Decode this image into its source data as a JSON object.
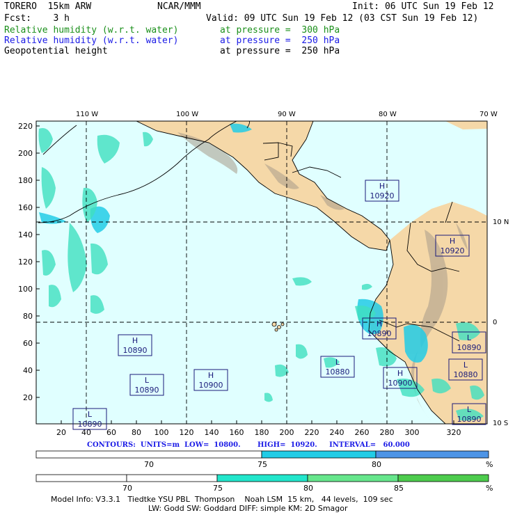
{
  "header": {
    "model": "TORERO  15km ARW",
    "org": "NCAR/MMM",
    "init": "Init: 06 UTC Sun 19 Feb 12",
    "fcst": "Fcst:    3 h",
    "valid": "Valid: 09 UTC Sun 19 Feb 12 (03 CST Sun 19 Feb 12)",
    "fields": [
      {
        "name": "Relative humidity (w.r.t. water)",
        "level": "at pressure =  300 hPa",
        "color": "#1a8f1a"
      },
      {
        "name": "Relative humidity (w.r.t. water)",
        "level": "at pressure =  250 hPa",
        "color": "#1a1ae6"
      },
      {
        "name": "Geopotential height",
        "level": "at pressure =  250 hPa",
        "color": "#000000"
      }
    ]
  },
  "map": {
    "lon_labels": [
      "110 W",
      "100 W",
      "90 W",
      "80 W",
      "70 W"
    ],
    "lat_labels": [
      "10 N",
      "0",
      "10 S"
    ],
    "y_ticks": [
      "220",
      "200",
      "180",
      "160",
      "140",
      "120",
      "100",
      "80",
      "60",
      "40",
      "20"
    ],
    "x_ticks": [
      "20",
      "40",
      "60",
      "80",
      "100",
      "120",
      "140",
      "160",
      "180",
      "200",
      "220",
      "240",
      "260",
      "280",
      "300",
      "320"
    ],
    "highs_lows": [
      {
        "type": "H",
        "value": "10920"
      },
      {
        "type": "H",
        "value": "10920"
      },
      {
        "type": "H",
        "value": "10890"
      },
      {
        "type": "H",
        "value": "10890"
      },
      {
        "type": "L",
        "value": "10890"
      },
      {
        "type": "H",
        "value": "10900"
      },
      {
        "type": "L",
        "value": "10880"
      },
      {
        "type": "H",
        "value": "10900"
      },
      {
        "type": "L",
        "value": "10890"
      },
      {
        "type": "L",
        "value": "10880"
      },
      {
        "type": "L",
        "value": "10890"
      },
      {
        "type": "L",
        "value": "10890"
      }
    ]
  },
  "contours_text": "CONTOURS:  UNITS=m  LOW=  10800.       HIGH=  10920.     INTERVAL=   60.000",
  "colorbar_250": {
    "labels": [
      "70",
      "75",
      "80",
      "%"
    ],
    "colors": [
      "#ffffff",
      "#22cce6",
      "#4d94e6"
    ]
  },
  "colorbar_300": {
    "labels": [
      "70",
      "75",
      "80",
      "85",
      "%"
    ],
    "colors": [
      "#ffffff",
      "#22e6cc",
      "#66e68c",
      "#4dcc4d"
    ]
  },
  "model_info": {
    "line1": "Model Info: V3.3.1   Tiedtke YSU PBL  Thompson    Noah LSM  15 km,   44 levels,  109 sec",
    "line2": "LW: Godd SW: Goddard DIFF: simple KM: 2D Smagor"
  }
}
